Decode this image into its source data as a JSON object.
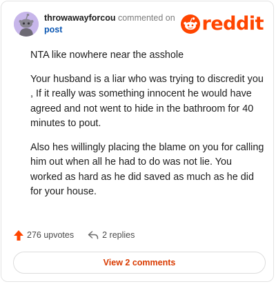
{
  "comment": {
    "username": "throwawayforcou",
    "action_text": "commented on",
    "target_link": "post",
    "avatar_icon": "snoo-avatar-icon",
    "avatar_color": "#c7b6ea",
    "paragraphs": [
      "NTA like nowhere near the asshole",
      "Your husband is a liar who was trying to discredit you , If it really was something innocent he would have agreed and not went to hide in the bathroom for 40 minutes to pout.",
      "Also hes willingly placing the blame on you for calling him out when all he had to do was not lie. You worked as hard as he did saved as much as he did for your house."
    ]
  },
  "brand": {
    "name": "reddit",
    "color": "#ff4500",
    "icon": "reddit-snoo-icon"
  },
  "actions": {
    "upvotes": "276 upvotes",
    "replies": "2 replies",
    "upvote_icon": "upvote-arrow-icon",
    "reply_icon": "reply-arrow-icon",
    "upvote_color": "#ff4500"
  },
  "footer": {
    "view_comments_label": "View 2 comments",
    "link_color": "#d93a00"
  }
}
